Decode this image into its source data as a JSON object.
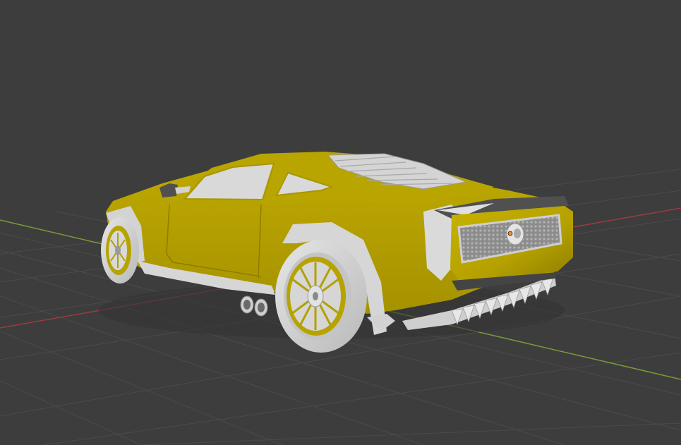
{
  "viewport": {
    "background_color": "#3d3d3d",
    "grid_color": "#4a4a4a",
    "x_axis_color": "#9b3b45",
    "y_axis_color": "#7a9a3a",
    "object": {
      "type": "car-mesh",
      "body_color": "#b8a400",
      "trim_color": "#d8d8d8",
      "selected": false
    },
    "origin_marker_color": "#f08a24"
  }
}
